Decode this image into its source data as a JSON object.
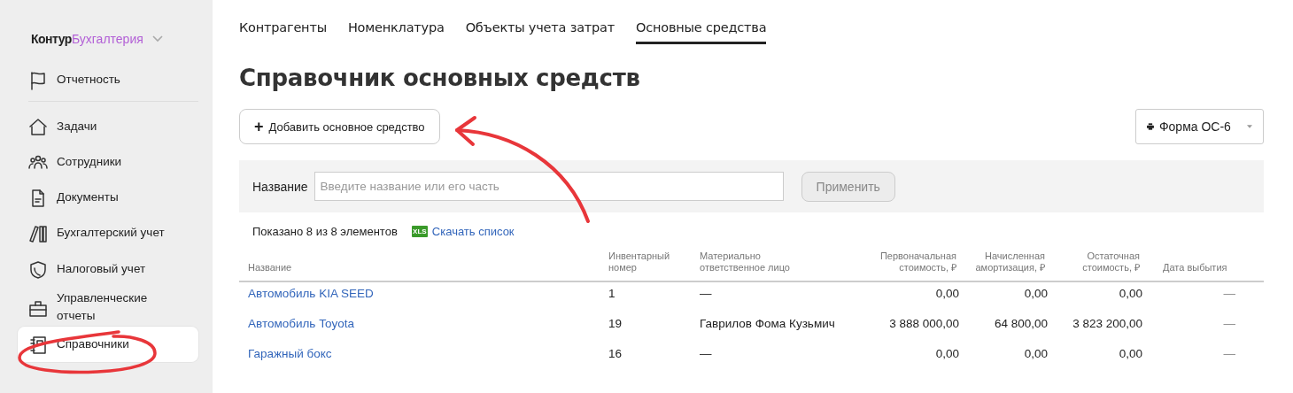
{
  "sidebar": {
    "logo": {
      "brand": "Контур",
      "product": "Бухгалтерия"
    },
    "items": [
      {
        "label": "Отчетность",
        "selected": false
      },
      {
        "label": "Задачи",
        "selected": false
      },
      {
        "label": "Сотрудники",
        "selected": false
      },
      {
        "label": "Документы",
        "selected": false
      },
      {
        "label": "Бухгалтерский учет",
        "selected": false
      },
      {
        "label": "Налоговый учет",
        "selected": false
      },
      {
        "label": "Управленческие отчеты",
        "selected": false
      },
      {
        "label": "Справочники",
        "selected": true
      }
    ]
  },
  "tabs": [
    {
      "label": "Контрагенты",
      "selected": false
    },
    {
      "label": "Номенклатура",
      "selected": false
    },
    {
      "label": "Объекты учета затрат",
      "selected": false
    },
    {
      "label": "Основные средства",
      "selected": true
    }
  ],
  "title": "Справочник основных средств",
  "add_button": {
    "icon": "+",
    "label": "Добавить основное средство"
  },
  "print_dropdown": {
    "label": "Форма ОС-6"
  },
  "filter": {
    "label": "Название",
    "placeholder": "Введите название или его часть",
    "apply_button": {
      "label": "Применить",
      "disabled": true
    }
  },
  "summary": "Показано 8 из 8 элементов",
  "download_link": {
    "icon_text": "XLS",
    "label": "Скачать список"
  },
  "table": {
    "columns": [
      "Название",
      "Инвентарный номер",
      "Материально ответственное лицо",
      "Первоначальная стоимость, ₽",
      "Начисленная амортизация, ₽",
      "Остаточная стоимость, ₽",
      "Дата выбытия"
    ],
    "rows": [
      [
        "Автомобиль KIA SEED",
        "1",
        "—",
        "0,00",
        "0,00",
        "0,00",
        "—"
      ],
      [
        "Автомобиль Toyota",
        "19",
        "Гаврилов Фома Кузьмич",
        "3 888 000,00",
        "64 800,00",
        "3 823 200,00",
        "—"
      ],
      [
        "Гаражный бокс",
        "16",
        "—",
        "0,00",
        "0,00",
        "0,00",
        "—"
      ]
    ]
  }
}
